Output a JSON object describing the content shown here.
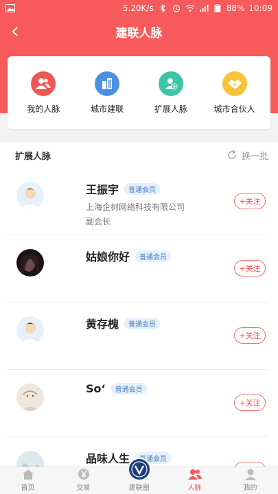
{
  "status_bar": {
    "speed": "5.20K/s",
    "battery": "88%",
    "time": "10:09"
  },
  "header": {
    "title": "建联人脉"
  },
  "menu": [
    {
      "label": "我的人脉",
      "icon": "people-icon",
      "color": "#f05656"
    },
    {
      "label": "城市建联",
      "icon": "building-icon",
      "color": "#4f8fe3"
    },
    {
      "label": "扩展人脉",
      "icon": "add-user-icon",
      "color": "#3cc6a8"
    },
    {
      "label": "城市合伙人",
      "icon": "handshake-icon",
      "color": "#f5c537"
    }
  ],
  "list": {
    "title": "扩展人脉",
    "refresh_label": "换一批",
    "badge_label": "普通会员",
    "follow_label": "+关注",
    "people": [
      {
        "name": "王振宇",
        "company": "上海企树网络科技有限公司",
        "position": "副会长",
        "avatar": "default-avatar"
      },
      {
        "name": "姑娘你好",
        "company": "",
        "position": "",
        "avatar": "photo-avatar"
      },
      {
        "name": "黄存槐",
        "company": "",
        "position": "",
        "avatar": "default-avatar"
      },
      {
        "name": "So‘",
        "company": "",
        "position": "",
        "avatar": "doll-avatar"
      },
      {
        "name": "品味人生",
        "company": "",
        "position": "",
        "avatar": "landscape-avatar"
      }
    ]
  },
  "tabbar": [
    {
      "label": "首页",
      "icon": "home-icon"
    },
    {
      "label": "交易",
      "icon": "yen-icon"
    },
    {
      "label": "建联圈",
      "icon": "logo-icon"
    },
    {
      "label": "人脉",
      "icon": "contacts-icon",
      "active": true
    },
    {
      "label": "我的",
      "icon": "user-icon"
    }
  ]
}
